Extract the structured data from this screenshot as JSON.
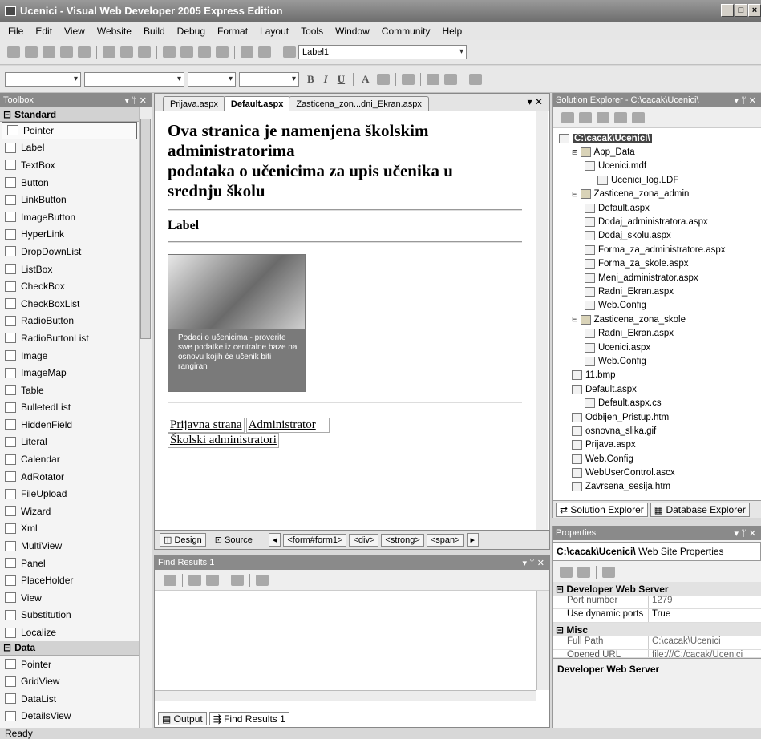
{
  "window": {
    "title": "Ucenici - Visual Web Developer 2005 Express Edition"
  },
  "menu": [
    "File",
    "Edit",
    "View",
    "Website",
    "Build",
    "Debug",
    "Format",
    "Layout",
    "Tools",
    "Window",
    "Community",
    "Help"
  ],
  "toolbar": {
    "target_combo": "Label1"
  },
  "toolbox": {
    "title": "Toolbox",
    "standard_label": "Standard",
    "standard": [
      "Pointer",
      "Label",
      "TextBox",
      "Button",
      "LinkButton",
      "ImageButton",
      "HyperLink",
      "DropDownList",
      "ListBox",
      "CheckBox",
      "CheckBoxList",
      "RadioButton",
      "RadioButtonList",
      "Image",
      "ImageMap",
      "Table",
      "BulletedList",
      "HiddenField",
      "Literal",
      "Calendar",
      "AdRotator",
      "FileUpload",
      "Wizard",
      "Xml",
      "MultiView",
      "Panel",
      "PlaceHolder",
      "View",
      "Substitution",
      "Localize"
    ],
    "data_label": "Data",
    "data": [
      "Pointer",
      "GridView",
      "DataList",
      "DetailsView"
    ]
  },
  "editor": {
    "tabs": [
      "Prijava.aspx",
      "Default.aspx",
      "Zasticena_zon...dni_Ekran.aspx"
    ],
    "heading_lines": [
      "Ova stranica je namenjena školskim",
      "administratorima",
      "podataka o učenicima za upis učenika u",
      "srednju školu"
    ],
    "label_text": "Label",
    "banner_text": "Podaci o učenicima - proverite swe podatke iz centralne baze na osnovu kojih će učenik biti rangiran",
    "links": [
      "Prijavna strana",
      "Administrator",
      "Školski administratori"
    ],
    "view_design": "Design",
    "view_source": "Source",
    "crumbs": [
      "<form#form1>",
      "<div>",
      "<strong>",
      "<span>"
    ]
  },
  "find": {
    "title": "Find Results 1",
    "tab_output": "Output",
    "tab_find": "Find Results 1"
  },
  "solution": {
    "title": "Solution Explorer - C:\\cacak\\Ucenici\\",
    "tree": [
      {
        "label": "C:\\cacak\\Ucenici\\",
        "level": 0,
        "bold": true
      },
      {
        "label": "App_Data",
        "level": 1,
        "folder": true
      },
      {
        "label": "Ucenici.mdf",
        "level": 2
      },
      {
        "label": "Ucenici_log.LDF",
        "level": 3
      },
      {
        "label": "Zasticena_zona_admin",
        "level": 1,
        "folder": true
      },
      {
        "label": "Default.aspx",
        "level": 2
      },
      {
        "label": "Dodaj_administratora.aspx",
        "level": 2
      },
      {
        "label": "Dodaj_skolu.aspx",
        "level": 2
      },
      {
        "label": "Forma_za_administratore.aspx",
        "level": 2
      },
      {
        "label": "Forma_za_skole.aspx",
        "level": 2
      },
      {
        "label": "Meni_administrator.aspx",
        "level": 2
      },
      {
        "label": "Radni_Ekran.aspx",
        "level": 2
      },
      {
        "label": "Web.Config",
        "level": 2
      },
      {
        "label": "Zasticena_zona_skole",
        "level": 1,
        "folder": true
      },
      {
        "label": "Radni_Ekran.aspx",
        "level": 2
      },
      {
        "label": "Ucenici.aspx",
        "level": 2
      },
      {
        "label": "Web.Config",
        "level": 2
      },
      {
        "label": "11.bmp",
        "level": 1
      },
      {
        "label": "Default.aspx",
        "level": 1
      },
      {
        "label": "Default.aspx.cs",
        "level": 2
      },
      {
        "label": "Odbijen_Pristup.htm",
        "level": 1
      },
      {
        "label": "osnovna_slika.gif",
        "level": 1
      },
      {
        "label": "Prijava.aspx",
        "level": 1
      },
      {
        "label": "Web.Config",
        "level": 1
      },
      {
        "label": "WebUserControl.ascx",
        "level": 1
      },
      {
        "label": "Zavrsena_sesija.htm",
        "level": 1
      }
    ],
    "tab_solution": "Solution Explorer",
    "tab_database": "Database Explorer"
  },
  "properties": {
    "title": "Properties",
    "object_bold": "C:\\cacak\\Ucenici\\",
    "object_rest": "Web Site Properties",
    "cat_dev": "Developer Web Server",
    "port_k": "Port number",
    "port_v": "1279",
    "dyn_k": "Use dynamic ports",
    "dyn_v": "True",
    "cat_misc": "Misc",
    "path_k": "Full Path",
    "path_v": "C:\\cacak\\Ucenici",
    "url_k": "Opened URL",
    "url_v": "file:///C:/cacak/Ucenici",
    "desc": "Developer Web Server"
  },
  "status": "Ready"
}
